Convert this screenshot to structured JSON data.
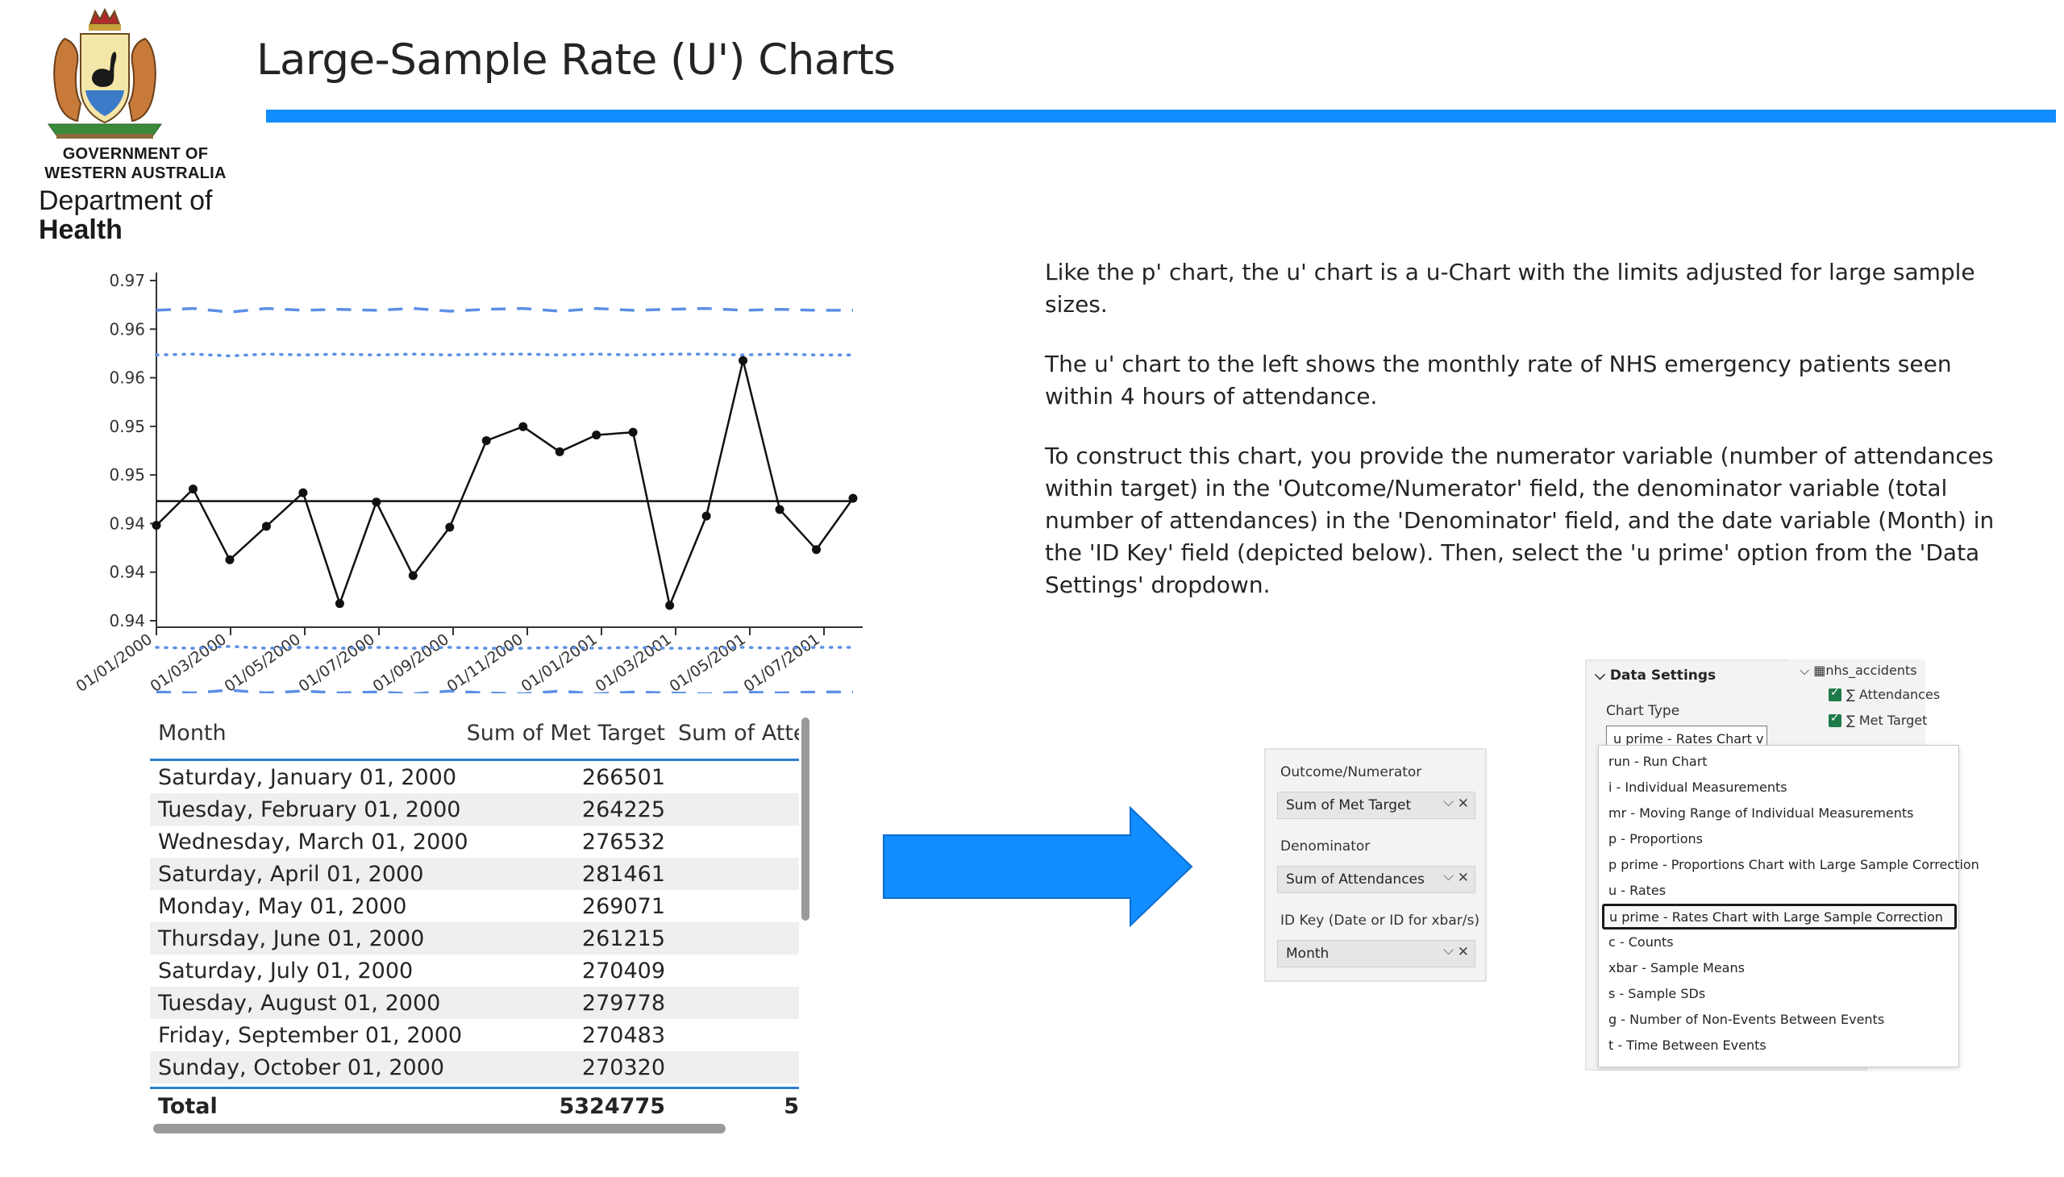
{
  "logo": {
    "gov_line1": "GOVERNMENT OF",
    "gov_line2": "WESTERN AUSTRALIA",
    "dept_line1": "Department of",
    "dept_line2": "Health"
  },
  "page_title": "Large-Sample Rate (U') Charts",
  "colors": {
    "accent": "#118DFF",
    "limits": "#5B8FE6",
    "arrow": "#118DFF"
  },
  "description": [
    "Like the p' chart, the u' chart is a u-Chart with the limits adjusted for large sample sizes.",
    "The u' chart to the left shows the monthly rate of NHS emergency patients seen within 4 hours of attendance.",
    "To construct this chart, you provide the numerator variable (number of attendances within target) in the 'Outcome/Numerator' field, the denominator variable (total number of attendances) in the 'Denominator' field, and the date variable (Month) in the 'ID Key' field (depicted below). Then, select the 'u prime' option from the 'Data Settings' dropdown."
  ],
  "chart_data": {
    "type": "line",
    "x": [
      "01/01/2000",
      "01/02/2000",
      "01/03/2000",
      "01/04/2000",
      "01/05/2000",
      "01/06/2000",
      "01/07/2000",
      "01/08/2000",
      "01/09/2000",
      "01/10/2000",
      "01/11/2000",
      "01/12/2000",
      "01/01/2001",
      "01/02/2001",
      "01/03/2001",
      "01/04/2001",
      "01/05/2001",
      "01/06/2001",
      "01/07/2001",
      "01/08/2001"
    ],
    "x_tick_labels": [
      "01/01/2000",
      "01/03/2000",
      "01/05/2000",
      "01/07/2000",
      "01/09/2000",
      "01/11/2000",
      "01/01/2001",
      "01/03/2001",
      "01/05/2001",
      "01/07/2001"
    ],
    "y_tick_labels": [
      "0.97",
      "0.96",
      "0.96",
      "0.95",
      "0.95",
      "0.94",
      "0.94",
      "0.94"
    ],
    "ylim": [
      0.937,
      0.9725
    ],
    "series": [
      {
        "values": [
          0.9469,
          0.9508,
          0.9432,
          0.9468,
          0.9504,
          0.9385,
          0.9494,
          0.9415,
          0.9467,
          0.956,
          0.9575,
          0.9548,
          0.9566,
          0.9569,
          0.9383,
          0.9479,
          0.9646,
          0.9486,
          0.9443,
          0.9498
        ]
      },
      {
        "values": [
          0.9495,
          0.9495,
          0.9495,
          0.9495,
          0.9495,
          0.9495,
          0.9495,
          0.9495,
          0.9495,
          0.9495,
          0.9495,
          0.9495,
          0.9495,
          0.9495,
          0.9495,
          0.9495,
          0.9495,
          0.9495,
          0.9495,
          0.9495
        ]
      },
      {
        "values": [
          0.9652,
          0.9653,
          0.9651,
          0.9653,
          0.9652,
          0.9653,
          0.9652,
          0.9653,
          0.9652,
          0.9653,
          0.9653,
          0.9652,
          0.9653,
          0.9652,
          0.9653,
          0.9653,
          0.9652,
          0.9653,
          0.9652,
          0.9652
        ]
      },
      {
        "values": [
          0.9338,
          0.9337,
          0.9339,
          0.9337,
          0.9338,
          0.9337,
          0.9338,
          0.9337,
          0.9338,
          0.9337,
          0.9337,
          0.9338,
          0.9337,
          0.9338,
          0.9337,
          0.9337,
          0.9338,
          0.9337,
          0.9338,
          0.9338
        ]
      },
      {
        "values": [
          0.97,
          0.9702,
          0.9698,
          0.9702,
          0.97,
          0.9701,
          0.97,
          0.9702,
          0.9699,
          0.9701,
          0.9702,
          0.9699,
          0.9702,
          0.97,
          0.9701,
          0.9702,
          0.97,
          0.9701,
          0.97,
          0.97
        ]
      },
      {
        "values": [
          0.929,
          0.9289,
          0.9292,
          0.9289,
          0.9291,
          0.9289,
          0.929,
          0.9288,
          0.9291,
          0.9289,
          0.9288,
          0.9291,
          0.9288,
          0.929,
          0.9289,
          0.9288,
          0.929,
          0.9289,
          0.929,
          0.929
        ]
      }
    ]
  },
  "table": {
    "headers": [
      "Month",
      "Sum of Met Target",
      "Sum of Atter"
    ],
    "rows": [
      [
        "Saturday, January 01, 2000",
        "266501"
      ],
      [
        "Tuesday, February 01, 2000",
        "264225"
      ],
      [
        "Wednesday, March 01, 2000",
        "276532"
      ],
      [
        "Saturday, April 01, 2000",
        "281461"
      ],
      [
        "Monday, May 01, 2000",
        "269071"
      ],
      [
        "Thursday, June 01, 2000",
        "261215"
      ],
      [
        "Saturday, July 01, 2000",
        "270409"
      ],
      [
        "Tuesday, August 01, 2000",
        "279778"
      ],
      [
        "Friday, September 01, 2000",
        "270483"
      ],
      [
        "Sunday, October 01, 2000",
        "270320"
      ]
    ],
    "total_label": "Total",
    "total_met": "5324775",
    "total_att": "5"
  },
  "field_panel": {
    "outcome_label": "Outcome/Numerator",
    "outcome_value": "Sum of Met Target",
    "denominator_label": "Denominator",
    "denominator_value": "Sum of Attendances",
    "idkey_label": "ID Key (Date or ID for xbar/s)",
    "idkey_value": "Month",
    "chevron": "⌵",
    "remove": "✕"
  },
  "settings": {
    "header": "Data Settings",
    "chart_type_label": "Chart Type",
    "selected": "u prime - Rates Chart v",
    "options": [
      "run - Run Chart",
      "i - Individual Measurements",
      "mr - Moving Range of Individual Measurements",
      "p - Proportions",
      "p prime - Proportions Chart with Large Sample Correction",
      "u - Rates",
      "u prime - Rates Chart with Large Sample Correction",
      "c - Counts",
      "xbar - Sample Means",
      "s - Sample SDs",
      "g - Number of Non-Events Between Events",
      "t - Time Between Events"
    ],
    "dataset": "nhs_accidents",
    "fields": [
      "Attendances",
      "Met Target"
    ],
    "sigma": "∑"
  }
}
